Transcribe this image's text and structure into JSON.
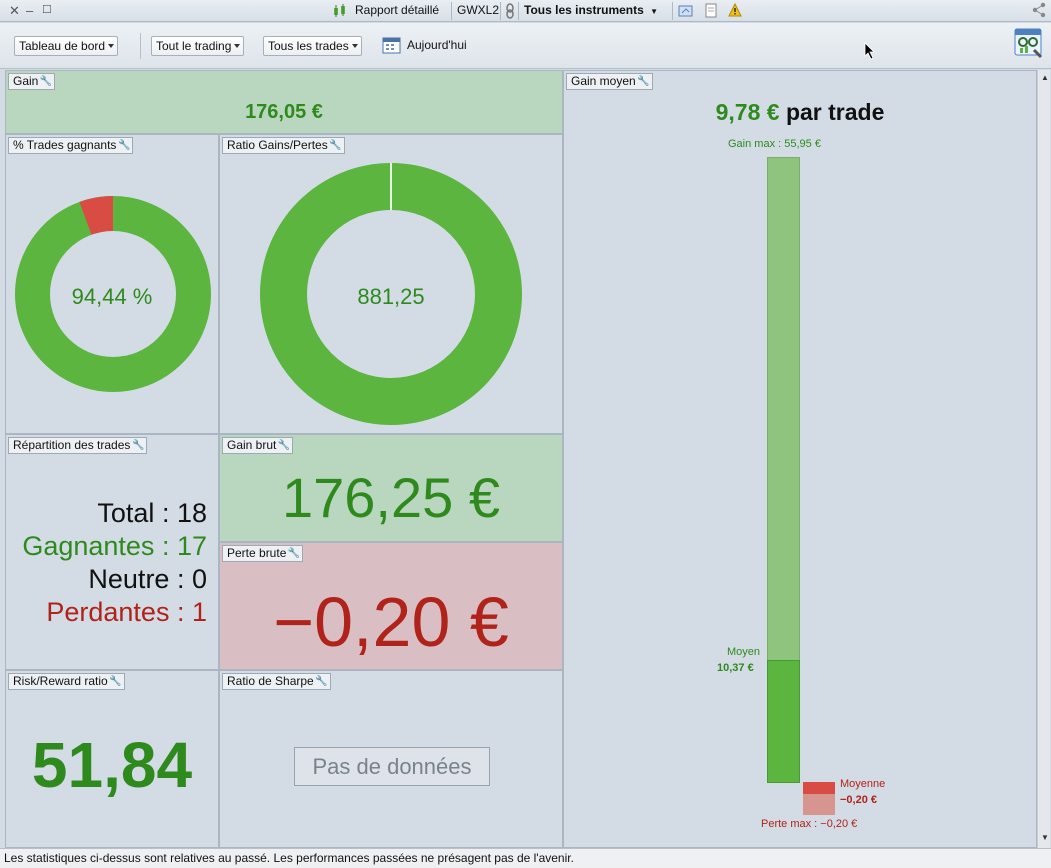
{
  "titlebar": {
    "report_label": "Rapport détaillé",
    "account": "GWXL2",
    "instruments": "Tous les instruments"
  },
  "toolbar": {
    "dashboard": "Tableau de bord",
    "trading": "Tout le trading",
    "trades": "Tous les trades",
    "today": "Aujourd'hui"
  },
  "panels": {
    "gain": {
      "title": "Gain",
      "value": "176,05 €"
    },
    "win_pct": {
      "title": "% Trades gagnants",
      "value": "94,44 %",
      "percent": 94.44
    },
    "ratio": {
      "title": "Ratio Gains/Pertes",
      "value": "881,25",
      "percent": 99.9
    },
    "distribution": {
      "title": "Répartition des trades",
      "total_label": "Total",
      "total": "18",
      "win_label": "Gagnantes",
      "win": "17",
      "neutral_label": "Neutre",
      "neutral": "0",
      "loss_label": "Perdantes",
      "loss": "1"
    },
    "gross_gain": {
      "title": "Gain brut",
      "value": "176,25 €"
    },
    "gross_loss": {
      "title": "Perte brute",
      "value": "−0,20 €"
    },
    "risk_reward": {
      "title": "Risk/Reward ratio",
      "value": "51,84"
    },
    "sharpe": {
      "title": "Ratio de Sharpe",
      "empty": "Pas de données"
    },
    "avg_gain": {
      "title": "Gain moyen",
      "headline_value": "9,78 €",
      "headline_suffix": "par trade",
      "max_gain_label": "Gain max : 55,95 €",
      "avg_label": "Moyen",
      "avg_value": "10,37 €",
      "avg_loss_label": "Moyenne",
      "avg_loss_value": "−0,20 €",
      "max_loss_label": "Perte max : −0,20 €",
      "max_gain": 55.95,
      "avg_win": 10.37
    }
  },
  "footer": "Les statistiques ci-dessus sont relatives au passé. Les performances passées ne présagent pas de l'avenir.",
  "colors": {
    "green": "#5bb53f",
    "red": "#d94c43",
    "green_text": "#2f8a1d",
    "red_text": "#b0231a"
  }
}
